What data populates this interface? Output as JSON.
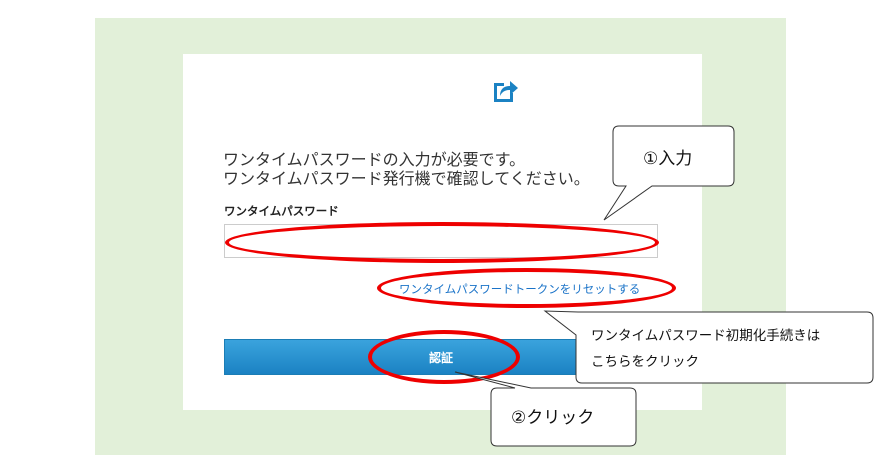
{
  "login": {
    "logo_icon": "share-arrow-icon",
    "message_line1": "ワンタイムパスワードの入力が必要です。",
    "message_line2": "ワンタイムパスワード発行機で確認してください。",
    "field_label": "ワンタイムパスワード",
    "field_value": "",
    "reset_link": "ワンタイムパスワードトークンをリセットする",
    "submit_label": "認証"
  },
  "annotations": {
    "callout_input": "①入力",
    "callout_reset_line1": "ワンタイムパスワード初期化手続きは",
    "callout_reset_line2": "こちらをクリック",
    "callout_click": "②クリック",
    "highlight_color": "#ee0000"
  },
  "colors": {
    "page_background": "#e2f0d9",
    "brand": "#1b82c3",
    "link": "#1a73c8"
  }
}
